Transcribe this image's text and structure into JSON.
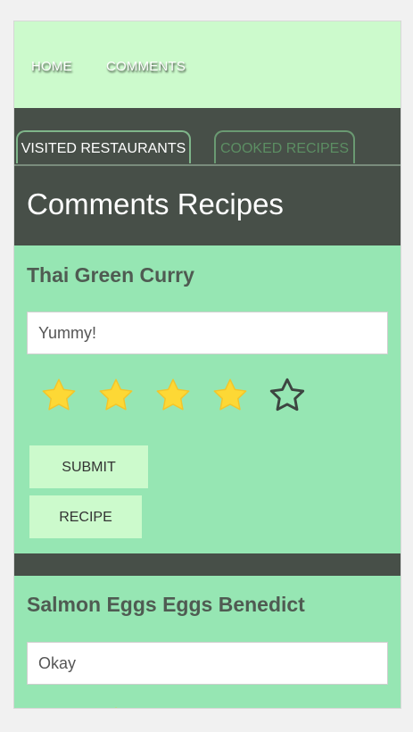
{
  "nav": {
    "home": "HOME",
    "comments": "COMMENTS"
  },
  "tabs": [
    {
      "label": "VISITED RESTAURANTS",
      "active": true
    },
    {
      "label": "COOKED RECIPES",
      "active": false
    }
  ],
  "page_title": "Comments Recipes",
  "cards": [
    {
      "title": "Thai Green Curry",
      "comment": "Yummy!",
      "rating": 4,
      "max_rating": 5,
      "submit_label": "SUBMIT",
      "recipe_label": "RECIPE"
    },
    {
      "title": "Salmon Eggs Eggs Benedict",
      "comment": "Okay"
    }
  ],
  "colors": {
    "nav_bg": "#ccfacc",
    "dark_bg": "#474f48",
    "card_bg": "#96e6b3",
    "star_fill": "#fdd835",
    "star_outline": "#3d4541"
  }
}
